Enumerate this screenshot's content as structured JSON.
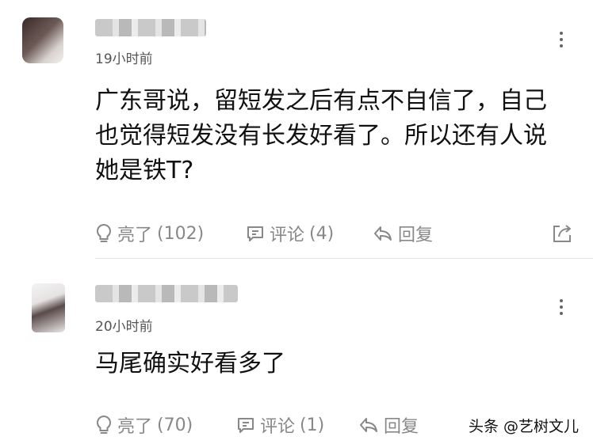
{
  "comments": [
    {
      "time": "19小时前",
      "content": "广东哥说，留短发之后有点不自信了，自己也觉得短发没有长发好看了。所以还有人说她是铁T?",
      "like_label": "亮了",
      "like_count": "(102)",
      "comment_label": "评论",
      "comment_count": "(4)",
      "reply_label": "回复"
    },
    {
      "time": "20小时前",
      "content": "马尾确实好看多了",
      "like_label": "亮了",
      "like_count": "(70)",
      "comment_label": "评论",
      "comment_count": "(1)",
      "reply_label": "回复"
    }
  ],
  "watermark": "头条 @艺树文儿",
  "icons": {
    "like": "lightbulb-icon",
    "comment": "speech-bubble-icon",
    "reply": "reply-arrow-icon",
    "share": "share-icon",
    "more": "more-vertical-icon"
  },
  "colors": {
    "text": "#111111",
    "meta": "#555555",
    "action": "#888888",
    "divider": "#e6e6e6"
  }
}
